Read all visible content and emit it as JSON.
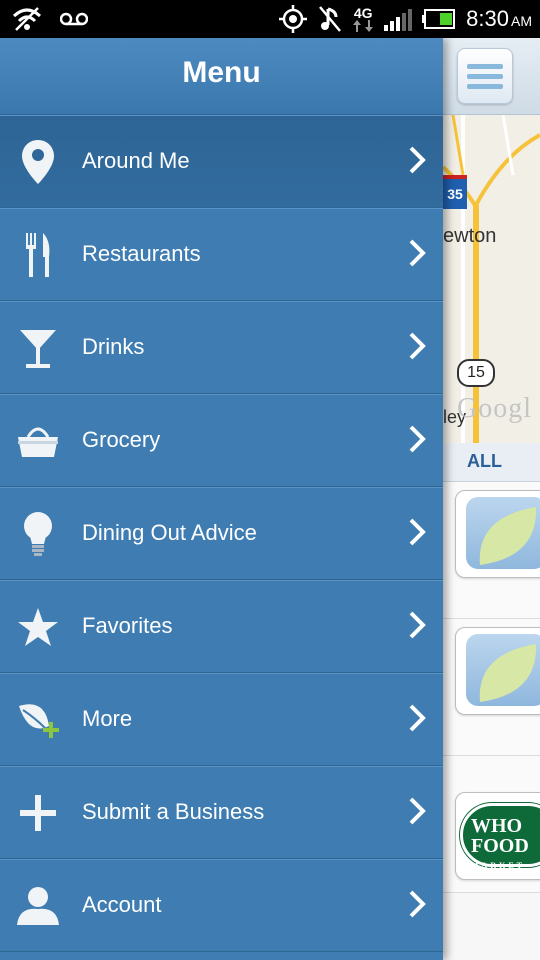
{
  "status_bar": {
    "network": "4G",
    "time": "8:30",
    "ampm": "AM"
  },
  "drawer": {
    "title": "Menu",
    "items": [
      {
        "label": "Around Me",
        "icon": "location-pin-icon",
        "active": true
      },
      {
        "label": "Restaurants",
        "icon": "fork-knife-icon",
        "active": false
      },
      {
        "label": "Drinks",
        "icon": "cocktail-glass-icon",
        "active": false
      },
      {
        "label": "Grocery",
        "icon": "shopping-basket-icon",
        "active": false
      },
      {
        "label": "Dining Out Advice",
        "icon": "lightbulb-icon",
        "active": false
      },
      {
        "label": "Favorites",
        "icon": "star-icon",
        "active": false
      },
      {
        "label": "More",
        "icon": "leaf-plus-icon",
        "active": false
      },
      {
        "label": "Submit a Business",
        "icon": "plus-icon",
        "active": false
      },
      {
        "label": "Account",
        "icon": "user-icon",
        "active": false
      }
    ]
  },
  "background_screen": {
    "map": {
      "place_label": "ewton",
      "place_label_2": "ley",
      "route_number": "15",
      "interstate_number": "35",
      "attribution": "Googl"
    },
    "filter_tab": "ALL",
    "list_logo_text": [
      "WHO",
      "FOOD",
      "MARKET"
    ]
  },
  "colors": {
    "drawer_bg": "#3e7cb2",
    "drawer_active": "#2f6798",
    "header_bg": "#4a87bd"
  }
}
